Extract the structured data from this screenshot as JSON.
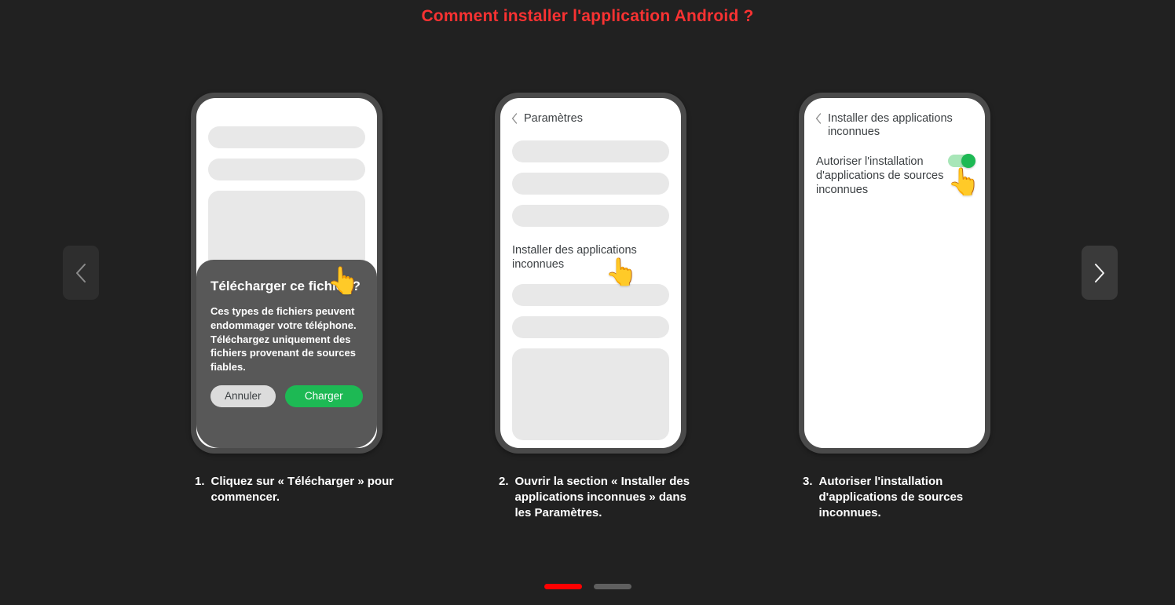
{
  "page": {
    "title": "Comment installer l'application Android ?",
    "title_color": "#f93232",
    "background_color": "#212121"
  },
  "carousel": {
    "prev_label": "‹",
    "next_label": "›",
    "prev_icon": "chevron-left-icon",
    "next_icon": "chevron-right-icon",
    "dots": [
      {
        "active": true
      },
      {
        "active": false
      }
    ],
    "active_dot_color": "#ff0000",
    "inactive_dot_color": "#5f5f5f"
  },
  "steps": [
    {
      "number": "1.",
      "caption": "Cliquez sur « Télécharger » pour commencer.",
      "phone": {
        "dialog": {
          "title": "Télécharger ce fichier ?",
          "body": "Ces types de fichiers peuvent endommager votre téléphone. Téléchargez uniquement des fichiers provenant de sources fiables.",
          "cancel_label": "Annuler",
          "confirm_label": "Charger",
          "confirm_color": "#1db954",
          "cancel_color": "#dcdcdc"
        },
        "hand_icon": "pointing-hand-icon",
        "hand_glyph": "👆"
      }
    },
    {
      "number": "2.",
      "caption": "Ouvrir la section « Installer des applications inconnues » dans les Paramètres.",
      "phone": {
        "header": "Paramètres",
        "back_icon": "chevron-left-icon",
        "item_label": "Installer des applications inconnues",
        "hand_icon": "pointing-hand-icon",
        "hand_glyph": "👆"
      }
    },
    {
      "number": "3.",
      "caption": "Autoriser l'installation d'applications de sources inconnues.",
      "phone": {
        "header": "Installer des applications inconnues",
        "back_icon": "chevron-left-icon",
        "item_label": "Autoriser l'installation d'applications de sources inconnues",
        "toggle": {
          "state": "on",
          "track_color": "#a8e6b8",
          "knob_color": "#1db954"
        },
        "hand_icon": "pointing-hand-icon",
        "hand_glyph": "👆"
      }
    }
  ]
}
